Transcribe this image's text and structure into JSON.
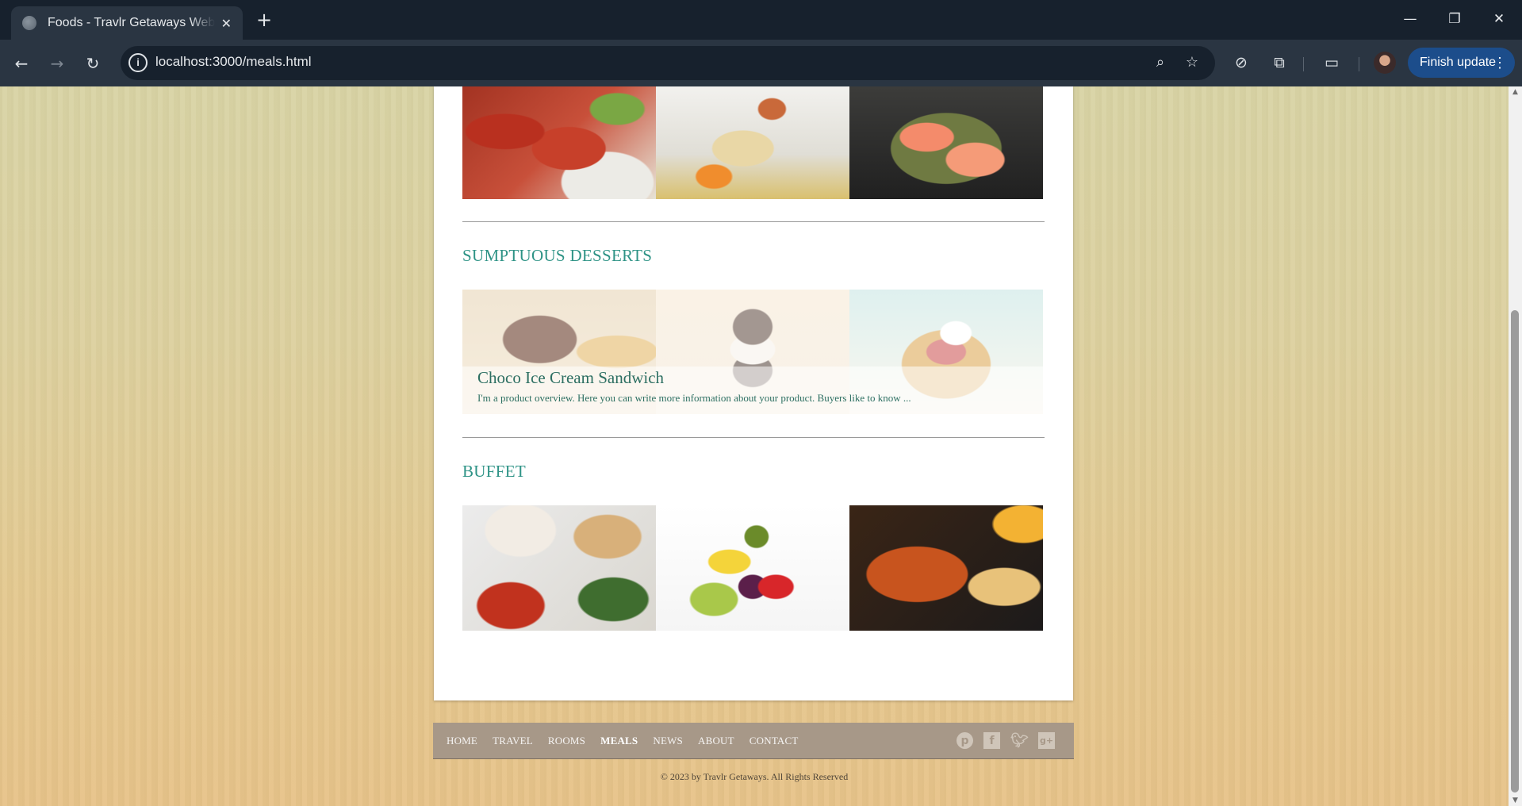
{
  "browser": {
    "tab_title": "Foods - Travlr Getaways Website",
    "tab_close": "✕",
    "new_tab": "+",
    "url": "localhost:3000/meals.html",
    "finish_update": "Finish update",
    "window_controls": {
      "minimize": "—",
      "maximize": "❐",
      "close": "✕"
    },
    "icons": [
      "back-icon",
      "forward-icon",
      "reload-icon",
      "site-info-icon",
      "zoom-icon",
      "bookmark-star-icon",
      "extension-blocked-icon",
      "extensions-icon",
      "tab-search-icon",
      "profile-avatar",
      "menu-icon"
    ]
  },
  "page": {
    "sections": [
      {
        "title": "",
        "images": [
          "Lobster",
          "Fish with vegetables",
          "Salmon in pan"
        ]
      },
      {
        "title": "SUMPTUOUS DESSERTS",
        "images": [
          "Chocolate dessert",
          "Ice cream sandwich",
          "Waffle with berries"
        ]
      },
      {
        "title": "BUFFET",
        "images": [
          "Buffet platters",
          "Fruits",
          "Sub sandwich"
        ]
      }
    ],
    "product": {
      "name": "Choco Ice Cream Sandwich",
      "overview": "I'm a product overview. Here you can write more information about your product. Buyers like to know ..."
    }
  },
  "footer": {
    "nav": [
      "HOME",
      "TRAVEL",
      "ROOMS",
      "MEALS",
      "NEWS",
      "ABOUT",
      "CONTACT"
    ],
    "active": "MEALS",
    "social": [
      "pinterest-icon",
      "facebook-icon",
      "twitter-icon",
      "google-plus-icon"
    ],
    "copyright": "© 2023 by Travlr Getaways. All Rights Reserved"
  },
  "colors": {
    "section_title": "#2e9386",
    "footer_bar": "#a79888",
    "browser_frame": "#17212d",
    "accent_button": "#1c4d8b"
  }
}
